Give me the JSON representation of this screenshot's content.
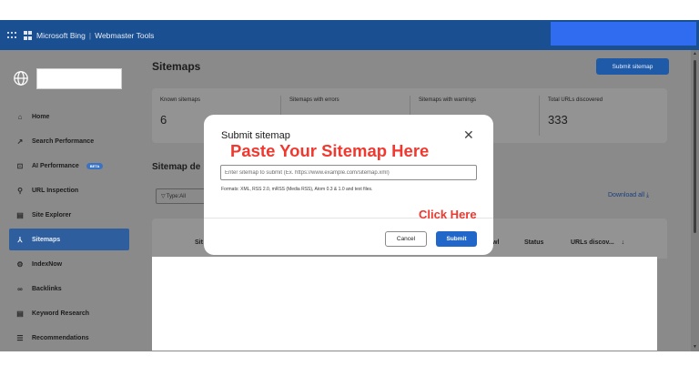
{
  "topbar": {
    "brand": "Microsoft Bing",
    "separator": "|",
    "product": "Webmaster Tools"
  },
  "sidebar": {
    "items": [
      {
        "label": "Home",
        "icon": "home-icon"
      },
      {
        "label": "Search Performance",
        "icon": "trend-icon"
      },
      {
        "label": "AI Performance",
        "icon": "ai-icon",
        "badge": "BETA"
      },
      {
        "label": "URL Inspection",
        "icon": "search-icon"
      },
      {
        "label": "Site Explorer",
        "icon": "document-icon"
      },
      {
        "label": "Sitemaps",
        "icon": "sitemap-icon",
        "active": true
      },
      {
        "label": "IndexNow",
        "icon": "gear-icon"
      },
      {
        "label": "Backlinks",
        "icon": "link-icon"
      },
      {
        "label": "Keyword Research",
        "icon": "document-icon"
      },
      {
        "label": "Recommendations",
        "icon": "list-icon"
      }
    ]
  },
  "main": {
    "title": "Sitemaps",
    "submit_button": "Submit sitemap",
    "stats": [
      {
        "label": "Known sitemaps",
        "value": "6"
      },
      {
        "label": "Sitemaps with errors",
        "value": ""
      },
      {
        "label": "Sitemaps with warnings",
        "value": ""
      },
      {
        "label": "Total URLs discovered",
        "value": "333"
      }
    ],
    "section_title": "Sitemap de",
    "filter_label": "Type:All",
    "download_label": "Download all",
    "columns": [
      "Sit",
      "wl",
      "Status",
      "URLs discov..."
    ]
  },
  "modal": {
    "title": "Submit sitemap",
    "input_placeholder": "Enter sitemap to submit (Ex. https://www.example.com/sitemap.xml)",
    "input_value": "",
    "formats_note": "Formats: XML, RSS 2.0, mRSS (Media RSS), Atom 0.3 & 1.0 and text files.",
    "cancel_label": "Cancel",
    "submit_label": "Submit"
  },
  "annotations": {
    "paste": "Paste Your Sitemap Here",
    "click": "Click Here"
  },
  "colors": {
    "topbar": "#1a4f91",
    "accent": "#2166c9",
    "annotation": "#f0382f",
    "overlay": "#8a8a8a"
  }
}
